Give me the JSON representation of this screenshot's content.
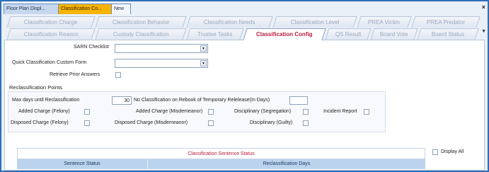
{
  "doc_tabs": [
    "Floor Plan Displ...",
    "Classification Co...",
    "New"
  ],
  "close_glyph": "×",
  "tabs_row1": [
    "Classification Charge",
    "Classification Behavior",
    "Classification Needs",
    "Classification Level",
    "PREA Victim",
    "PREA Predator"
  ],
  "tabs_row2": [
    "Classification Reason",
    "Custody Classification",
    "Trustee Tasks",
    "Classification Config",
    "QS Result",
    "Board Vote",
    "Board Status"
  ],
  "active_tab": "Classification Config",
  "form": {
    "sarn_label": "SARN Checklist",
    "sarn_value": "",
    "custom_form_label": "Quick Classification Custom Form",
    "custom_form_value": "",
    "retrieve_label": "Retrieve Prior Answers",
    "reclass_header": "Reclassification Points",
    "max_days_label": "Max days until Reclassification",
    "max_days_value": "30",
    "no_class_label": "No Classification on Rebook of Temporary Relelease(In Days)",
    "no_class_value": "",
    "checks": [
      "Added Charge (Felony)",
      "Added Charge (Misdemeanor)",
      "Disciplinary (Segregation)",
      "Incident Report",
      "Disposed Charge (Felony)",
      "Disposed Charge (Misdemeanor)",
      "Disciplinary (Guilty)"
    ]
  },
  "sentence": {
    "title": "Classification Sentence Status",
    "col1": "Sentence Status",
    "col2": "Reclassification Days",
    "display_all": "Display All"
  },
  "colors": {
    "border": "#2d6fb8",
    "active_tab_text": "#b81c3c",
    "doc_tab_active": "#f4b400",
    "header_fill": "#bcd3ee"
  }
}
